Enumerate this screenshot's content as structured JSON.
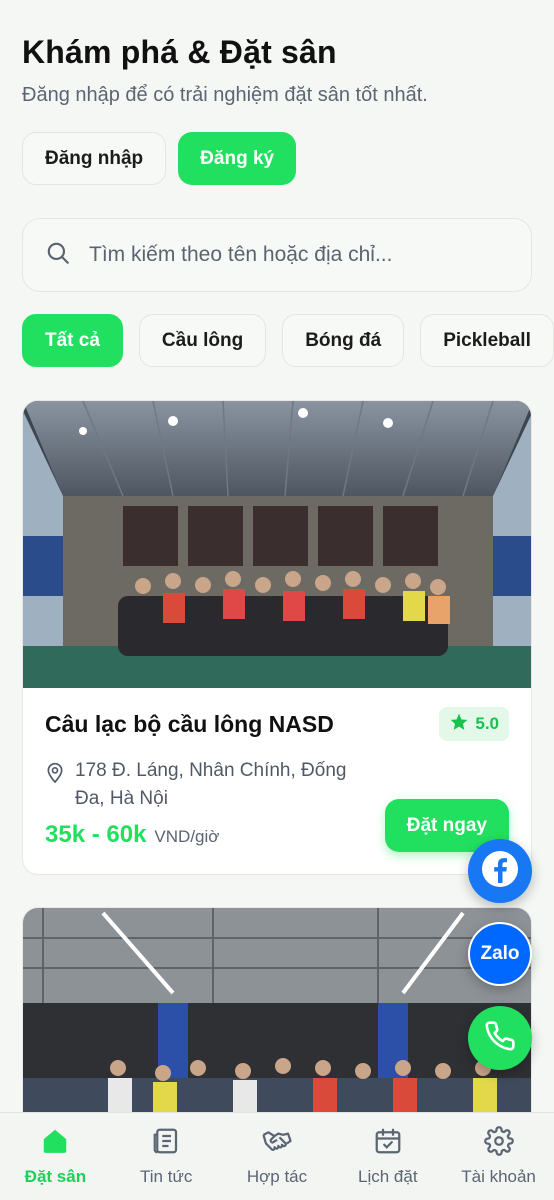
{
  "header": {
    "title": "Khám phá & Đặt sân",
    "subtitle": "Đăng nhập để có trải nghiệm đặt sân tốt nhất."
  },
  "auth": {
    "login_label": "Đăng nhập",
    "register_label": "Đăng ký"
  },
  "search": {
    "placeholder": "Tìm kiếm theo tên hoặc địa chỉ..."
  },
  "filters": [
    {
      "label": "Tất cả",
      "active": true
    },
    {
      "label": "Cầu lông",
      "active": false
    },
    {
      "label": "Bóng đá",
      "active": false
    },
    {
      "label": "Pickleball",
      "active": false
    }
  ],
  "venues": [
    {
      "name": "Câu lạc bộ cầu lông NASD",
      "rating": "5.0",
      "address": "178 Đ. Láng, Nhân Chính, Đống Đa, Hà Nội",
      "price": "35k - 60k",
      "price_unit": "VND/giờ",
      "book_label": "Đặt ngay"
    }
  ],
  "floating": {
    "zalo_label": "Zalo"
  },
  "bottom_nav": [
    {
      "label": "Đặt sân",
      "icon": "home-icon",
      "active": true
    },
    {
      "label": "Tin tức",
      "icon": "news-icon",
      "active": false
    },
    {
      "label": "Hợp tác",
      "icon": "handshake-icon",
      "active": false
    },
    {
      "label": "Lịch đặt",
      "icon": "calendar-icon",
      "active": false
    },
    {
      "label": "Tài khoản",
      "icon": "gear-icon",
      "active": false
    }
  ],
  "colors": {
    "accent": "#22e05f",
    "facebook": "#1877f2",
    "zalo": "#0068ff"
  }
}
